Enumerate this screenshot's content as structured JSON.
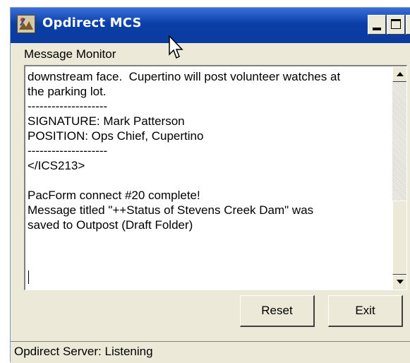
{
  "window": {
    "title": "Opdirect MCS",
    "controls": {
      "minimize_icon": "minimize-icon",
      "maximize_icon": "maximize-icon",
      "close_icon": "close-icon",
      "close_glyph": "×"
    }
  },
  "panel": {
    "label": "Message Monitor"
  },
  "message": {
    "lines": "downstream face.  Cupertino will post volunteer watches at\nthe parking lot.\n--------------------\nSIGNATURE: Mark Patterson\nPOSITION: Ops Chief, Cupertino\n--------------------\n</ICS213>\n\nPacForm connect #20 complete!\nMessage titled \"++Status of Stevens Creek Dam\" was\nsaved to Outpost (Draft Folder)"
  },
  "buttons": {
    "reset": "Reset",
    "exit": "Exit"
  },
  "status": {
    "text": "Opdirect Server: Listening"
  },
  "colors": {
    "titlebar": "#0a3fa8",
    "window_bg": "#ece9d8",
    "text_bg": "#ffffff"
  }
}
